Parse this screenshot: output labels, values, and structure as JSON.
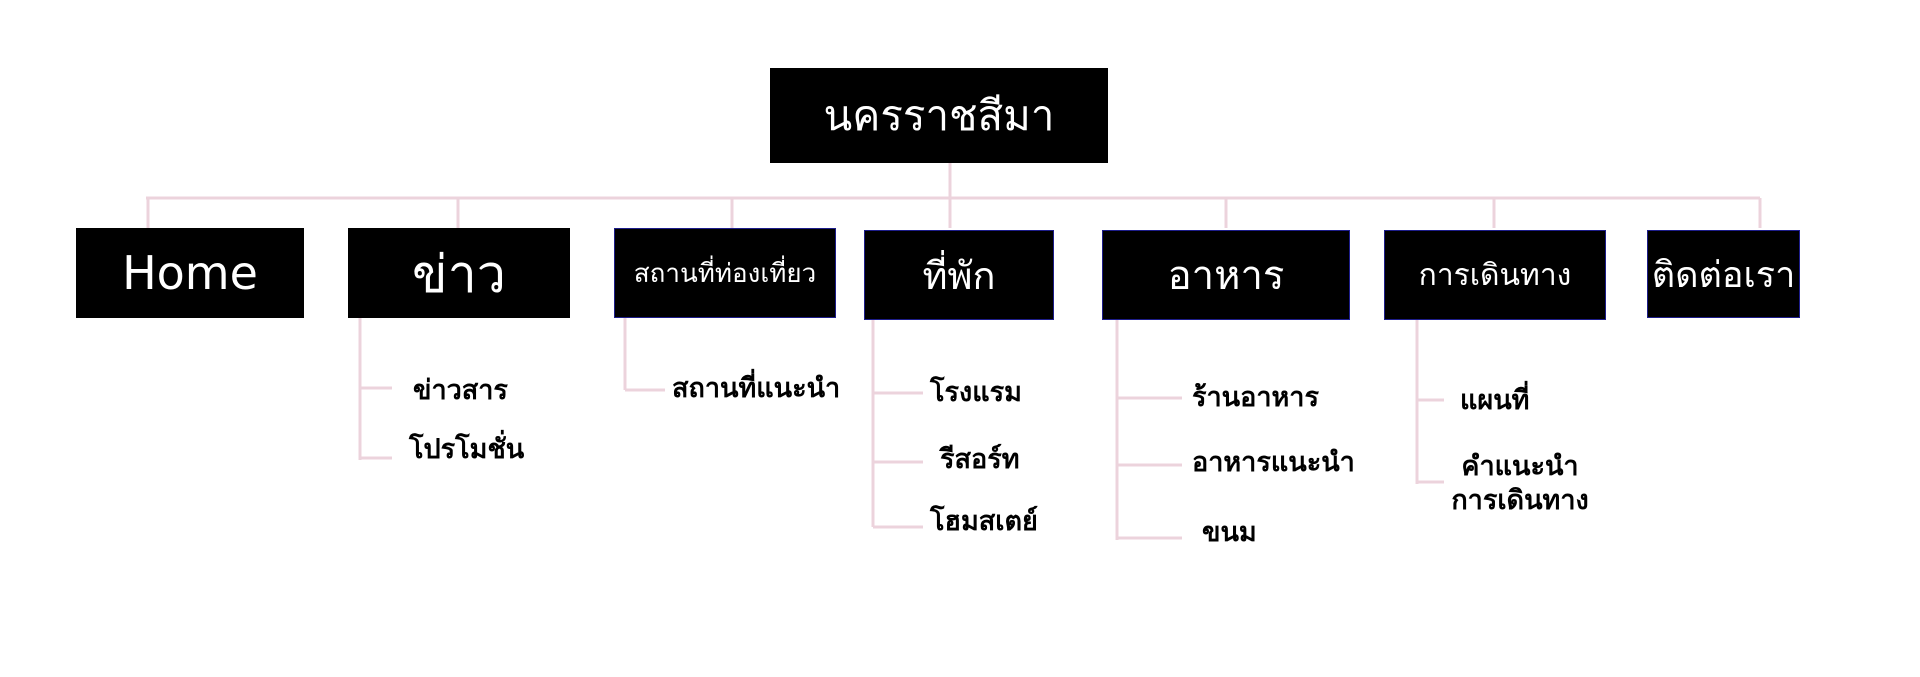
{
  "root": {
    "label": "นครราชสีมา"
  },
  "menu": [
    {
      "label": "Home",
      "children": []
    },
    {
      "label": "ข่าว",
      "children": [
        "ข่าวสาร",
        "โปรโมชั่น"
      ]
    },
    {
      "label": "สถานที่ท่องเที่ยว",
      "children": [
        "สถานที่แนะนำ"
      ]
    },
    {
      "label": "ที่พัก",
      "children": [
        "โรงแรม",
        "รีสอร์ท",
        "โฮมสเตย์"
      ]
    },
    {
      "label": "อาหาร",
      "children": [
        "ร้านอาหาร",
        "อาหารแนะนำ",
        "ขนม"
      ]
    },
    {
      "label": "การเดินทาง",
      "children": [
        "แผนที่",
        "คำแนะนำ\nการเดินทาง"
      ]
    },
    {
      "label": "ติดต่อเรา",
      "children": []
    }
  ],
  "colors": {
    "node_fill": "#000000",
    "node_text": "#ffffff",
    "connector": "#ecd3dc",
    "node_outline": "#1d1d8a",
    "sub_text": "#000000"
  }
}
